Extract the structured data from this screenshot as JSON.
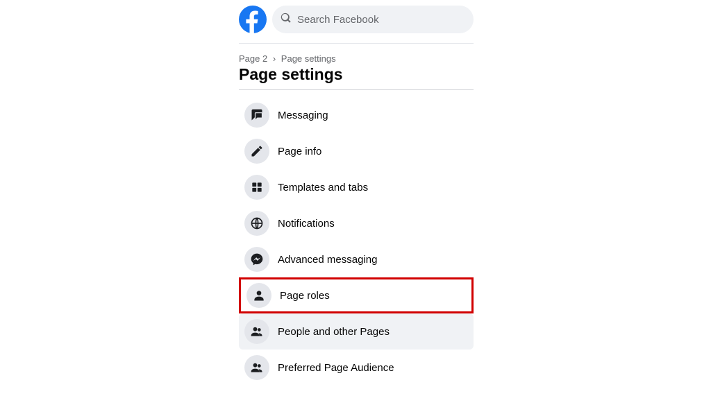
{
  "search": {
    "placeholder": "Search Facebook"
  },
  "breadcrumb": {
    "a": "Page 2",
    "sep": "›",
    "b": "Page settings"
  },
  "title": "Page settings",
  "menu": {
    "items": [
      {
        "label": "Messaging"
      },
      {
        "label": "Page info"
      },
      {
        "label": "Templates and tabs"
      },
      {
        "label": "Notifications"
      },
      {
        "label": "Advanced messaging"
      },
      {
        "label": "Page roles"
      },
      {
        "label": "People and other Pages"
      },
      {
        "label": "Preferred Page Audience"
      }
    ]
  }
}
